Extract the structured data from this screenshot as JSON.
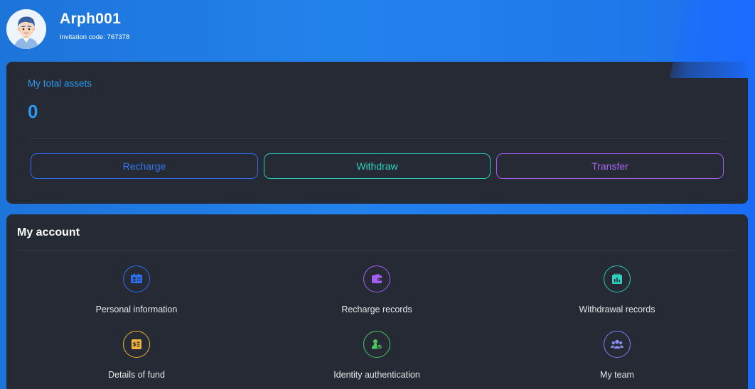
{
  "user": {
    "name": "Arph001",
    "invitation_code": "Invitation code: 767378"
  },
  "assets": {
    "label": "My total assets",
    "value": "0",
    "buttons": {
      "recharge": "Recharge",
      "withdraw": "Withdraw",
      "transfer": "Transfer"
    }
  },
  "account": {
    "title": "My account",
    "items": [
      {
        "label": "Personal information",
        "icon": "id-card-icon",
        "color": "#2f6ef0"
      },
      {
        "label": "Recharge records",
        "icon": "wallet-icon",
        "color": "#a35ff2"
      },
      {
        "label": "Withdrawal records",
        "icon": "calendar-chart-icon",
        "color": "#2ed0bf"
      },
      {
        "label": "Details of fund",
        "icon": "fund-bill-icon",
        "color": "#f0b43a"
      },
      {
        "label": "Identity authentication",
        "icon": "verified-user-icon",
        "color": "#48c85a"
      },
      {
        "label": "My team",
        "icon": "team-icon",
        "color": "#7c7ff2"
      }
    ]
  },
  "colors": {
    "accent_blue": "#2a9bf0",
    "card_bg": "#252a34",
    "header_gradient_start": "#1d74d9",
    "header_gradient_end": "#1a6cf5"
  }
}
